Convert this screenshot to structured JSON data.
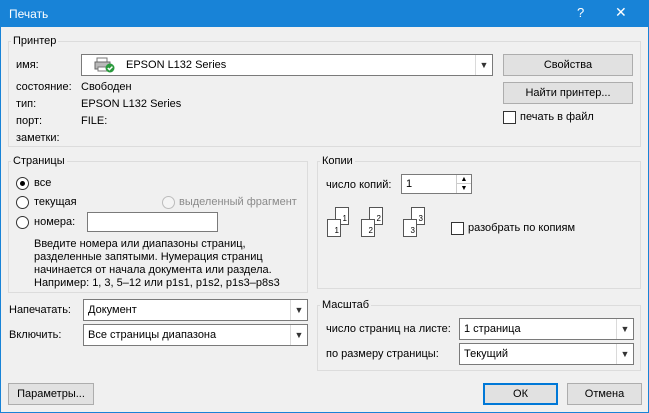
{
  "window": {
    "title": "Печать",
    "help_icon": "?",
    "close_icon": "✕"
  },
  "printer": {
    "legend": "Принтер",
    "name_label": "имя:",
    "name_value": "EPSON L132 Series",
    "status_label": "состояние:",
    "status_value": "Свободен",
    "type_label": "тип:",
    "type_value": "EPSON L132 Series",
    "port_label": "порт:",
    "port_value": "FILE:",
    "notes_label": "заметки:",
    "properties_button": "Свойства",
    "find_printer_button": "Найти принтер...",
    "print_to_file_label": "печать в файл"
  },
  "pages": {
    "legend": "Страницы",
    "all_label": "все",
    "current_label": "текущая",
    "selection_label": "выделенный фрагмент",
    "numbers_label": "номера:",
    "numbers_value": "",
    "hint_line1": "Введите номера или диапазоны страниц,",
    "hint_line2": "разделенные запятыми. Нумерация страниц",
    "hint_line3": "начинается от начала документа или раздела.",
    "hint_line4": "Например: 1, 3, 5–12 или p1s1, p1s2, p1s3–p8s3"
  },
  "copies": {
    "legend": "Копии",
    "count_label": "число копий:",
    "count_value": "1",
    "collate_label": "разобрать по копиям",
    "pages": [
      "1",
      "1",
      "2",
      "2",
      "3",
      "3"
    ]
  },
  "print_what": {
    "label": "Напечатать:",
    "value": "Документ"
  },
  "include": {
    "label": "Включить:",
    "value": "Все страницы диапазона"
  },
  "zoom": {
    "legend": "Масштаб",
    "pages_per_sheet_label": "число страниц на листе:",
    "pages_per_sheet_value": "1 страница",
    "scale_label": "по размеру страницы:",
    "scale_value": "Текущий"
  },
  "footer": {
    "options_button": "Параметры...",
    "ok_button": "ОК",
    "cancel_button": "Отмена"
  },
  "colors": {
    "accent": "#1883d7"
  },
  "icons": {
    "printer": "printer-icon",
    "dropdown": "chevron-down-icon"
  }
}
